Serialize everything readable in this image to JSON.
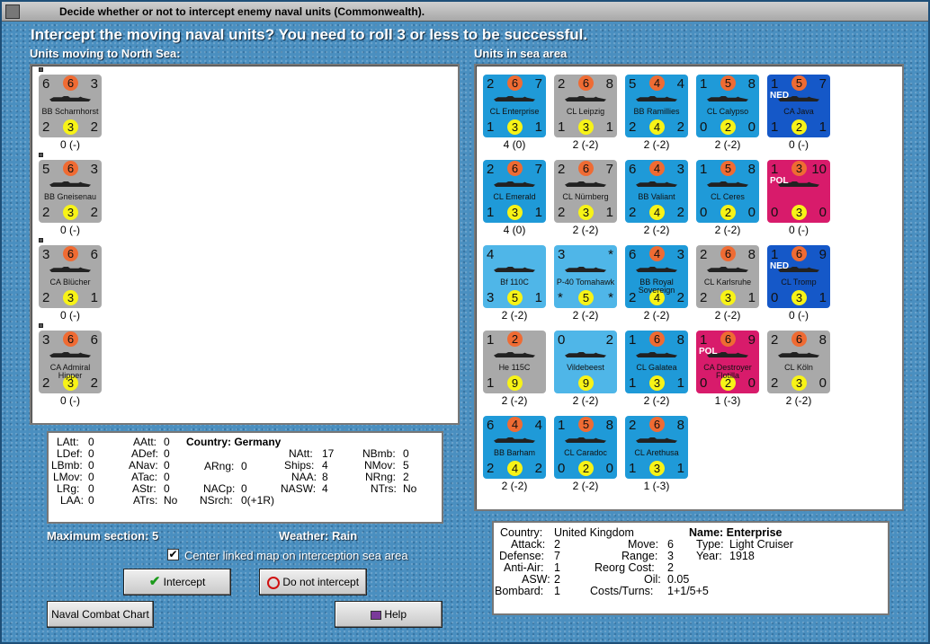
{
  "window": {
    "title": "Decide whether or not to intercept enemy naval units (Commonwealth)."
  },
  "heading": "Intercept the moving naval units?  You need to roll 3 or less to be successful.",
  "left_label": "Units moving to North Sea:",
  "right_label": "Units in sea area",
  "moving_units": [
    {
      "tl": "6",
      "oc": "6",
      "tr": "3",
      "bl": "2",
      "yc": "3",
      "br": "2",
      "name": "BB Scharnhorst",
      "cap": "0 (-)"
    },
    {
      "tl": "5",
      "oc": "6",
      "tr": "3",
      "bl": "2",
      "yc": "3",
      "br": "2",
      "name": "BB Gneisenau",
      "cap": "0 (-)"
    },
    {
      "tl": "3",
      "oc": "6",
      "tr": "6",
      "bl": "2",
      "yc": "3",
      "br": "1",
      "name": "CA Blücher",
      "cap": "0 (-)"
    },
    {
      "tl": "3",
      "oc": "6",
      "tr": "6",
      "bl": "2",
      "yc": "3",
      "br": "2",
      "name": "CA Admiral Hipper",
      "cap": "0 (-)"
    }
  ],
  "sea_units": [
    {
      "tl": "2",
      "oc": "6",
      "tr": "7",
      "bl": "1",
      "yc": "3",
      "br": "1",
      "name": "CL Enterprise",
      "cap": "4 (0)",
      "color": "blue"
    },
    {
      "tl": "2",
      "oc": "6",
      "tr": "8",
      "bl": "1",
      "yc": "3",
      "br": "1",
      "name": "CL Leipzig",
      "cap": "2 (-2)",
      "color": "grey"
    },
    {
      "tl": "5",
      "oc": "4",
      "tr": "4",
      "bl": "2",
      "yc": "4",
      "br": "2",
      "name": "BB Ramillies",
      "cap": "2 (-2)",
      "color": "blue"
    },
    {
      "tl": "1",
      "oc": "5",
      "tr": "8",
      "bl": "0",
      "yc": "2",
      "br": "0",
      "name": "CL Calypso",
      "cap": "2 (-2)",
      "color": "blue"
    },
    {
      "tl": "1",
      "oc": "5",
      "tr": "7",
      "bl": "1",
      "yc": "2",
      "br": "1",
      "name": "CA Java",
      "cap": "0 (-)",
      "color": "dblue",
      "nat": "NED"
    },
    {
      "tl": "2",
      "oc": "6",
      "tr": "7",
      "bl": "1",
      "yc": "3",
      "br": "1",
      "name": "CL Emerald",
      "cap": "4 (0)",
      "color": "blue"
    },
    {
      "tl": "2",
      "oc": "6",
      "tr": "7",
      "bl": "2",
      "yc": "3",
      "br": "1",
      "name": "CL Nürnberg",
      "cap": "2 (-2)",
      "color": "grey"
    },
    {
      "tl": "6",
      "oc": "4",
      "tr": "3",
      "bl": "2",
      "yc": "4",
      "br": "2",
      "name": "BB Valiant",
      "cap": "2 (-2)",
      "color": "blue"
    },
    {
      "tl": "1",
      "oc": "5",
      "tr": "8",
      "bl": "0",
      "yc": "2",
      "br": "0",
      "name": "CL Ceres",
      "cap": "2 (-2)",
      "color": "blue"
    },
    {
      "tl": "1",
      "oc": "3",
      "tr": "10",
      "bl": "0",
      "yc": "3",
      "br": "0",
      "name": "",
      "cap": "0 (-)",
      "color": "pink",
      "nat": "POL"
    },
    {
      "tl": "4",
      "oc": "",
      "tr": "",
      "bl": "3",
      "yc": "5",
      "br": "1",
      "name": "Bf 110C",
      "cap": "2 (-2)",
      "color": "lblue"
    },
    {
      "tl": "3",
      "oc": "",
      "tr": "*",
      "bl": "*",
      "yc": "5",
      "br": "*",
      "name": "P-40 Tomahawk",
      "cap": "2 (-2)",
      "color": "lblue"
    },
    {
      "tl": "6",
      "oc": "4",
      "tr": "3",
      "bl": "2",
      "yc": "4",
      "br": "2",
      "name": "BB Royal Sovereign",
      "cap": "2 (-2)",
      "color": "blue"
    },
    {
      "tl": "2",
      "oc": "6",
      "tr": "8",
      "bl": "2",
      "yc": "3",
      "br": "1",
      "name": "CL Karlsruhe",
      "cap": "2 (-2)",
      "color": "grey"
    },
    {
      "tl": "1",
      "oc": "6",
      "tr": "9",
      "bl": "0",
      "yc": "3",
      "br": "1",
      "name": "CL Tromp",
      "cap": "0 (-)",
      "color": "dblue",
      "nat": "NED"
    },
    {
      "tl": "1",
      "oc": "2",
      "tr": "",
      "bl": "1",
      "yc": "9",
      "br": "",
      "name": "He 115C",
      "cap": "2 (-2)",
      "color": "grey"
    },
    {
      "tl": "0",
      "oc": "",
      "tr": "2",
      "bl": "",
      "yc": "9",
      "br": "",
      "name": "Vildebeest",
      "cap": "2 (-2)",
      "color": "lblue"
    },
    {
      "tl": "1",
      "oc": "6",
      "tr": "8",
      "bl": "1",
      "yc": "3",
      "br": "1",
      "name": "CL Galatea",
      "cap": "2 (-2)",
      "color": "blue"
    },
    {
      "tl": "1",
      "oc": "6",
      "tr": "9",
      "bl": "0",
      "yc": "2",
      "br": "0",
      "name": "CA Destroyer Flotilla",
      "cap": "1 (-3)",
      "color": "pink",
      "nat": "POL"
    },
    {
      "tl": "2",
      "oc": "6",
      "tr": "8",
      "bl": "2",
      "yc": "3",
      "br": "0",
      "name": "CL Köln",
      "cap": "2 (-2)",
      "color": "grey"
    },
    {
      "tl": "6",
      "oc": "4",
      "tr": "4",
      "bl": "2",
      "yc": "4",
      "br": "2",
      "name": "BB Barham",
      "cap": "2 (-2)",
      "color": "blue"
    },
    {
      "tl": "1",
      "oc": "5",
      "tr": "8",
      "bl": "0",
      "yc": "2",
      "br": "0",
      "name": "CL Caradoc",
      "cap": "2 (-2)",
      "color": "blue"
    },
    {
      "tl": "2",
      "oc": "6",
      "tr": "8",
      "bl": "1",
      "yc": "3",
      "br": "1",
      "name": "CL Arethusa",
      "cap": "1 (-3)",
      "color": "blue"
    }
  ],
  "stats": {
    "latt": "LAtt:",
    "latt_v": "0",
    "ldef": "LDef:",
    "ldef_v": "0",
    "lbmb": "LBmb:",
    "lbmb_v": "0",
    "lmov": "LMov:",
    "lmov_v": "0",
    "lrg": "LRg:",
    "lrg_v": "0",
    "laa": "LAA:",
    "laa_v": "0",
    "aatt": "AAtt:",
    "aatt_v": "0",
    "adef": "ADef:",
    "adef_v": "0",
    "anav": "ANav:",
    "anav_v": "0",
    "atac": "ATac:",
    "atac_v": "0",
    "astr": "AStr:",
    "astr_v": "0",
    "atrs": "ATrs:",
    "atrs_v": "No",
    "country": "Country: Germany",
    "arng": "ARng:",
    "arng_v": "0",
    "nacp": "NACp:",
    "nacp_v": "0",
    "nsrch": "NSrch:",
    "nsrch_v": "0(+1R)",
    "natt": "NAtt:",
    "natt_v": "17",
    "ships": "Ships:",
    "ships_v": "4",
    "naa": "NAA:",
    "naa_v": "8",
    "nasw": "NASW:",
    "nasw_v": "4",
    "nbmb": "NBmb:",
    "nbmb_v": "0",
    "nmov": "NMov:",
    "nmov_v": "5",
    "nrng": "NRng:",
    "nrng_v": "2",
    "ntrs": "NTrs:",
    "ntrs_v": "No"
  },
  "max_section": "Maximum section: 5",
  "weather": "Weather:  Rain",
  "center_checkbox": "Center linked map on interception sea area",
  "buttons": {
    "intercept": "Intercept",
    "no_intercept": "Do not intercept",
    "chart": "Naval Combat Chart",
    "help": "Help"
  },
  "info": {
    "country": "Country:",
    "country_v": "United Kingdom",
    "attack": "Attack:",
    "attack_v": "2",
    "defense": "Defense:",
    "defense_v": "7",
    "antiair": "Anti-Air:",
    "antiair_v": "1",
    "asw": "ASW:",
    "asw_v": "2",
    "bombard": "Bombard:",
    "bombard_v": "1",
    "move": "Move:",
    "move_v": "6",
    "range": "Range:",
    "range_v": "3",
    "reorg": "Reorg Cost:",
    "reorg_v": "2",
    "oil": "Oil:",
    "oil_v": "0.05",
    "costs": "Costs/Turns:",
    "costs_v": "1+1/5+5",
    "name": "Name: Enterprise",
    "type": "Type:",
    "type_v": "Light Cruiser",
    "year": "Year:",
    "year_v": "1918"
  }
}
